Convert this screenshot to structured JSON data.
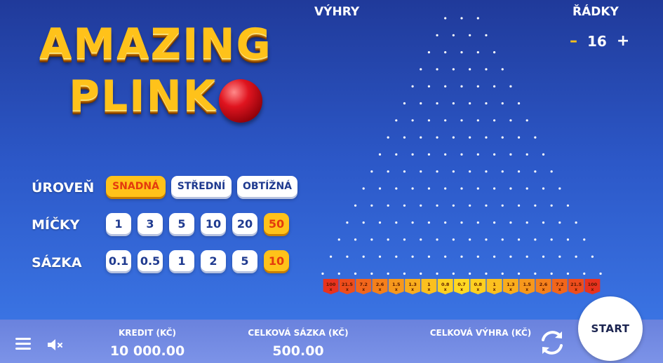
{
  "logo": {
    "line1": "AMAZING",
    "line2": "PLINK"
  },
  "header": {
    "wins_label": "VÝHRY",
    "rows_label": "ŘÁDKY",
    "rows_minus": "–",
    "rows_value": "16",
    "rows_plus": "+"
  },
  "level": {
    "label": "ÚROVEŇ",
    "options": [
      "SNADNÁ",
      "STŘEDNÍ",
      "OBTÍŽNÁ"
    ],
    "selected": 0
  },
  "balls": {
    "label": "MÍČKY",
    "options": [
      "1",
      "3",
      "5",
      "10",
      "20",
      "50"
    ],
    "selected": 5
  },
  "bet": {
    "label": "SÁZKA",
    "options": [
      "0.1",
      "0.5",
      "1",
      "2",
      "5",
      "10"
    ],
    "selected": 5
  },
  "board": {
    "rows": 16,
    "multipliers": [
      "100",
      "21.5",
      "7.2",
      "2.6",
      "1.5",
      "1.3",
      "1",
      "0.8",
      "0.7",
      "0.8",
      "1",
      "1.3",
      "1.5",
      "2.6",
      "7.2",
      "21.5",
      "100"
    ],
    "multiplier_suffix": "x",
    "bucket_colors": [
      "#e8321e",
      "#ee4d1c",
      "#f2661b",
      "#f5801b",
      "#f7981c",
      "#f9ad1d",
      "#fbc01f",
      "#fdd021",
      "#ffd823",
      "#fdd021",
      "#fbc01f",
      "#f9ad1d",
      "#f7981c",
      "#f5801b",
      "#f2661b",
      "#ee4d1c",
      "#e8321e"
    ]
  },
  "footer": {
    "credit_label": "KREDIT (KČ)",
    "credit_value": "10 000.00",
    "total_bet_label": "CELKOVÁ SÁZKA (KČ)",
    "total_bet_value": "500.00",
    "total_win_label": "CELKOVÁ VÝHRA (KČ)",
    "start_label": "START"
  },
  "icons": {
    "menu": "menu-icon",
    "sound": "sound-muted-icon",
    "refresh": "autoplay-icon"
  }
}
